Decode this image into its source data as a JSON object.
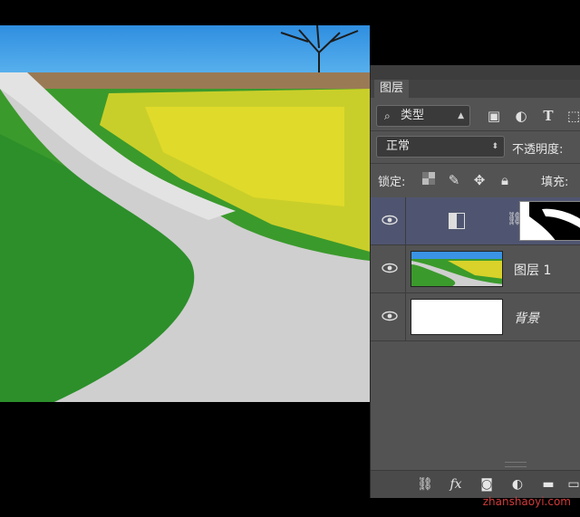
{
  "panel": {
    "tab_label": "图层",
    "filter": {
      "kind_label": "类型"
    },
    "blend": {
      "mode": "正常",
      "opacity_label": "不透明度:"
    },
    "lock": {
      "label": "锁定:",
      "fill_label": "填充:"
    },
    "layers": [
      {
        "name": "",
        "type": "adjustment",
        "selected": true
      },
      {
        "name": "图层 1",
        "type": "image",
        "selected": false
      },
      {
        "name": "背景",
        "type": "background",
        "selected": false
      }
    ]
  },
  "watermark": "zhanshaoyi.com",
  "colors": {
    "panel_bg": "#535353",
    "selected_layer": "#4f5570",
    "watermark": "#d23a3a"
  }
}
